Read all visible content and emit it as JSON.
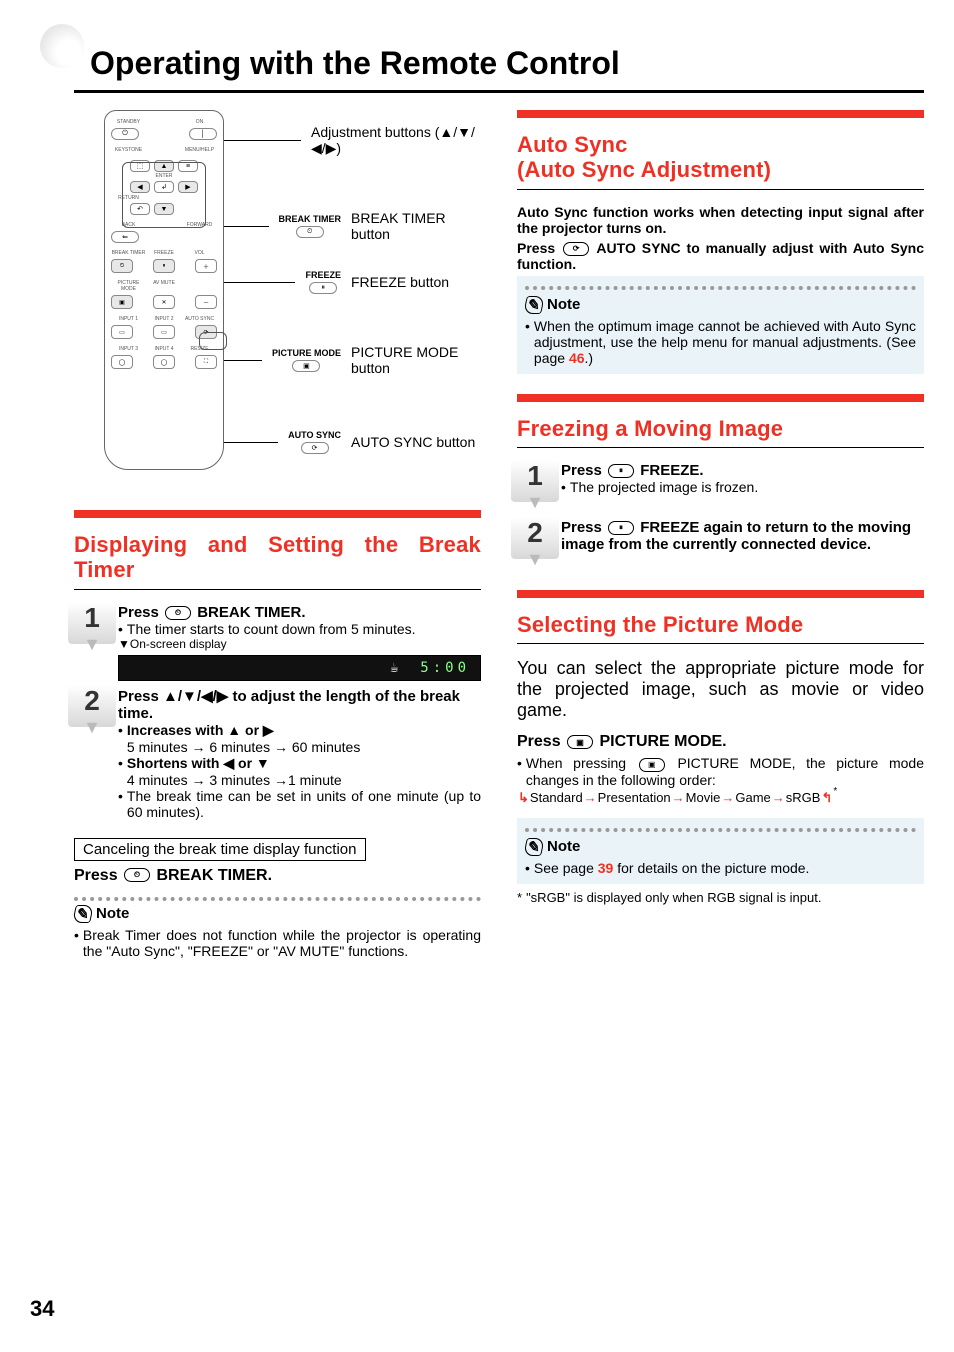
{
  "page_number": "34",
  "title": "Operating with the Remote Control",
  "remote": {
    "callout_adjust": "Adjustment buttons (▲/▼/◀/▶)",
    "break_timer_label": "BREAK TIMER",
    "break_timer_text": "BREAK TIMER button",
    "freeze_label": "FREEZE",
    "freeze_text": "FREEZE button",
    "picture_mode_label": "PICTURE MODE",
    "picture_mode_text": "PICTURE MODE button",
    "auto_sync_label": "AUTO SYNC",
    "auto_sync_text": "AUTO SYNC button",
    "btn_labels": {
      "standby": "STANDBY",
      "on": "ON",
      "keystone": "KEYSTONE",
      "menuhelp": "MENU/HELP",
      "enter": "ENTER",
      "return": "RETURN",
      "back": "BACK",
      "forward": "FORWARD",
      "breaktimer": "BREAK TIMER",
      "freeze": "FREEZE",
      "vol": "VOL",
      "picturemode": "PICTURE MODE",
      "avmute": "AV MUTE",
      "input1": "INPUT 1",
      "input2": "INPUT 2",
      "autosync": "AUTO SYNC",
      "input3": "INPUT 3",
      "input4": "INPUT 4",
      "resize": "RESIZE"
    }
  },
  "autosync": {
    "heading": "Auto Sync\n(Auto Sync Adjustment)",
    "para1": "Auto Sync function works when detecting input signal after the projector turns on.",
    "para2a": "Press ",
    "para2b": " AUTO SYNC to manually adjust with Auto Sync function.",
    "note_label": "Note",
    "note1a": "When the optimum image cannot be achieved with Auto Sync adjustment, use the help menu for manual adjustments. (See page ",
    "note1_page": "46",
    "note1b": ".)"
  },
  "breaktimer": {
    "heading": "Displaying and Setting the Break Timer",
    "step1_lead": "Press  BREAK TIMER.",
    "step1_bullet": "The timer starts to count down from 5 minutes.",
    "osd_label": "▼On-screen display",
    "osd_time": "5:00",
    "step2_lead": "Press ▲/▼/◀/▶ to adjust the length of the break time.",
    "step2_inc_lead": "Increases with ▲ or ▶",
    "step2_inc_detail": "5 minutes → 6 minutes → 60 minutes",
    "step2_dec_lead": "Shortens with ◀ or ▼",
    "step2_dec_detail": "4 minutes → 3 minutes →1 minute",
    "step2_bullet3": "The break time can be set in units of one minute (up to 60 minutes).",
    "cancel_box": "Canceling the break time display function",
    "cancel_lead": "Press  BREAK TIMER.",
    "note_label": "Note",
    "note1": "Break Timer does not function while the projector is operating the \"Auto Sync\", \"FREEZE\" or \"AV MUTE\" functions."
  },
  "freeze": {
    "heading": "Freezing a Moving Image",
    "step1_lead": "Press  FREEZE.",
    "step1_bullet": "The projected image is frozen.",
    "step2_lead": "Press  FREEZE again to return to the moving image from the currently connected device."
  },
  "picmode": {
    "heading": "Selecting the Picture Mode",
    "intro": "You can select the appropriate picture mode for the projected image, such as movie or video game.",
    "press_lead": "Press  PICTURE MODE.",
    "bullet1": "When pressing  PICTURE MODE, the picture mode changes in the following order:",
    "cycle": [
      "Standard",
      "Presentation",
      "Movie",
      "Game",
      "sRGB"
    ],
    "note_label": "Note",
    "note1a": "See page ",
    "note1_page": "39",
    "note1b": " for details on the picture mode.",
    "footnote": "\"sRGB\" is displayed only when RGB signal is input."
  }
}
